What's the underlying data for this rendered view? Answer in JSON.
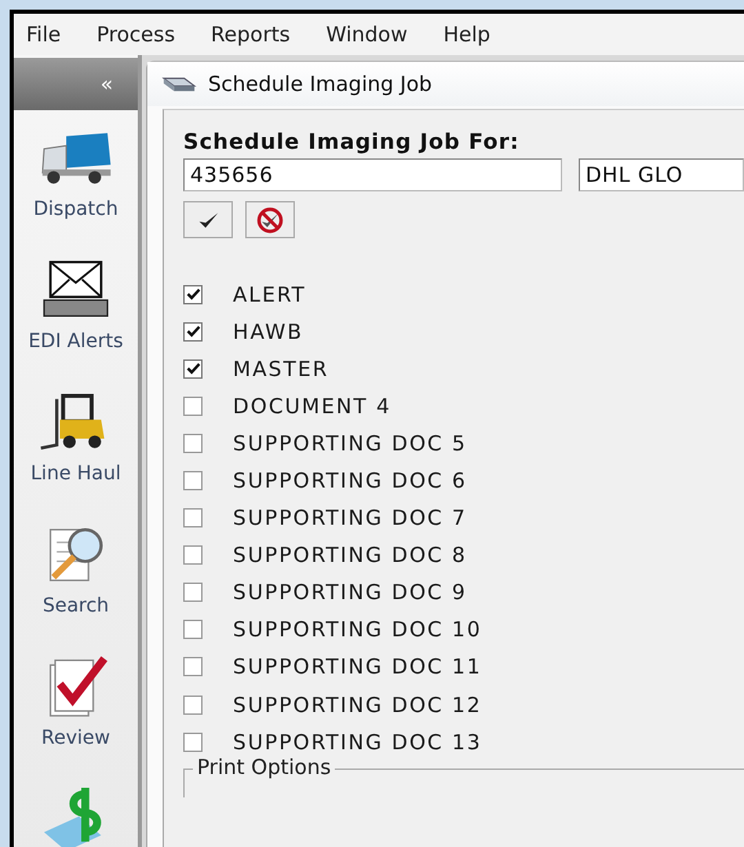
{
  "menu": [
    "File",
    "Process",
    "Reports",
    "Window",
    "Help"
  ],
  "sidebar": {
    "collapse": "«",
    "items": [
      {
        "kind": "truck",
        "label": "Dispatch"
      },
      {
        "kind": "envelope",
        "label": "EDI Alerts"
      },
      {
        "kind": "forklift",
        "label": "Line Haul"
      },
      {
        "kind": "search",
        "label": "Search"
      },
      {
        "kind": "review",
        "label": "Review"
      },
      {
        "kind": "money"
      }
    ]
  },
  "window": {
    "title": "Schedule Imaging Job"
  },
  "form": {
    "heading": "Schedule Imaging Job For:",
    "job_number": "435656",
    "company": "DHL GLO"
  },
  "documents": [
    {
      "label": "ALERT",
      "checked": true
    },
    {
      "label": "HAWB",
      "checked": true
    },
    {
      "label": "MASTER",
      "checked": true
    },
    {
      "label": "DOCUMENT 4",
      "checked": false
    },
    {
      "label": "SUPPORTING DOC 5",
      "checked": false
    },
    {
      "label": "SUPPORTING DOC 6",
      "checked": false
    },
    {
      "label": "SUPPORTING DOC 7",
      "checked": false
    },
    {
      "label": "SUPPORTING DOC 8",
      "checked": false
    },
    {
      "label": "SUPPORTING DOC 9",
      "checked": false
    },
    {
      "label": "SUPPORTING DOC 10",
      "checked": false
    },
    {
      "label": "SUPPORTING DOC 11",
      "checked": false
    },
    {
      "label": "SUPPORTING DOC 12",
      "checked": false
    },
    {
      "label": "SUPPORTING DOC 13",
      "checked": false
    }
  ],
  "print_options": {
    "legend": "Print Options"
  }
}
